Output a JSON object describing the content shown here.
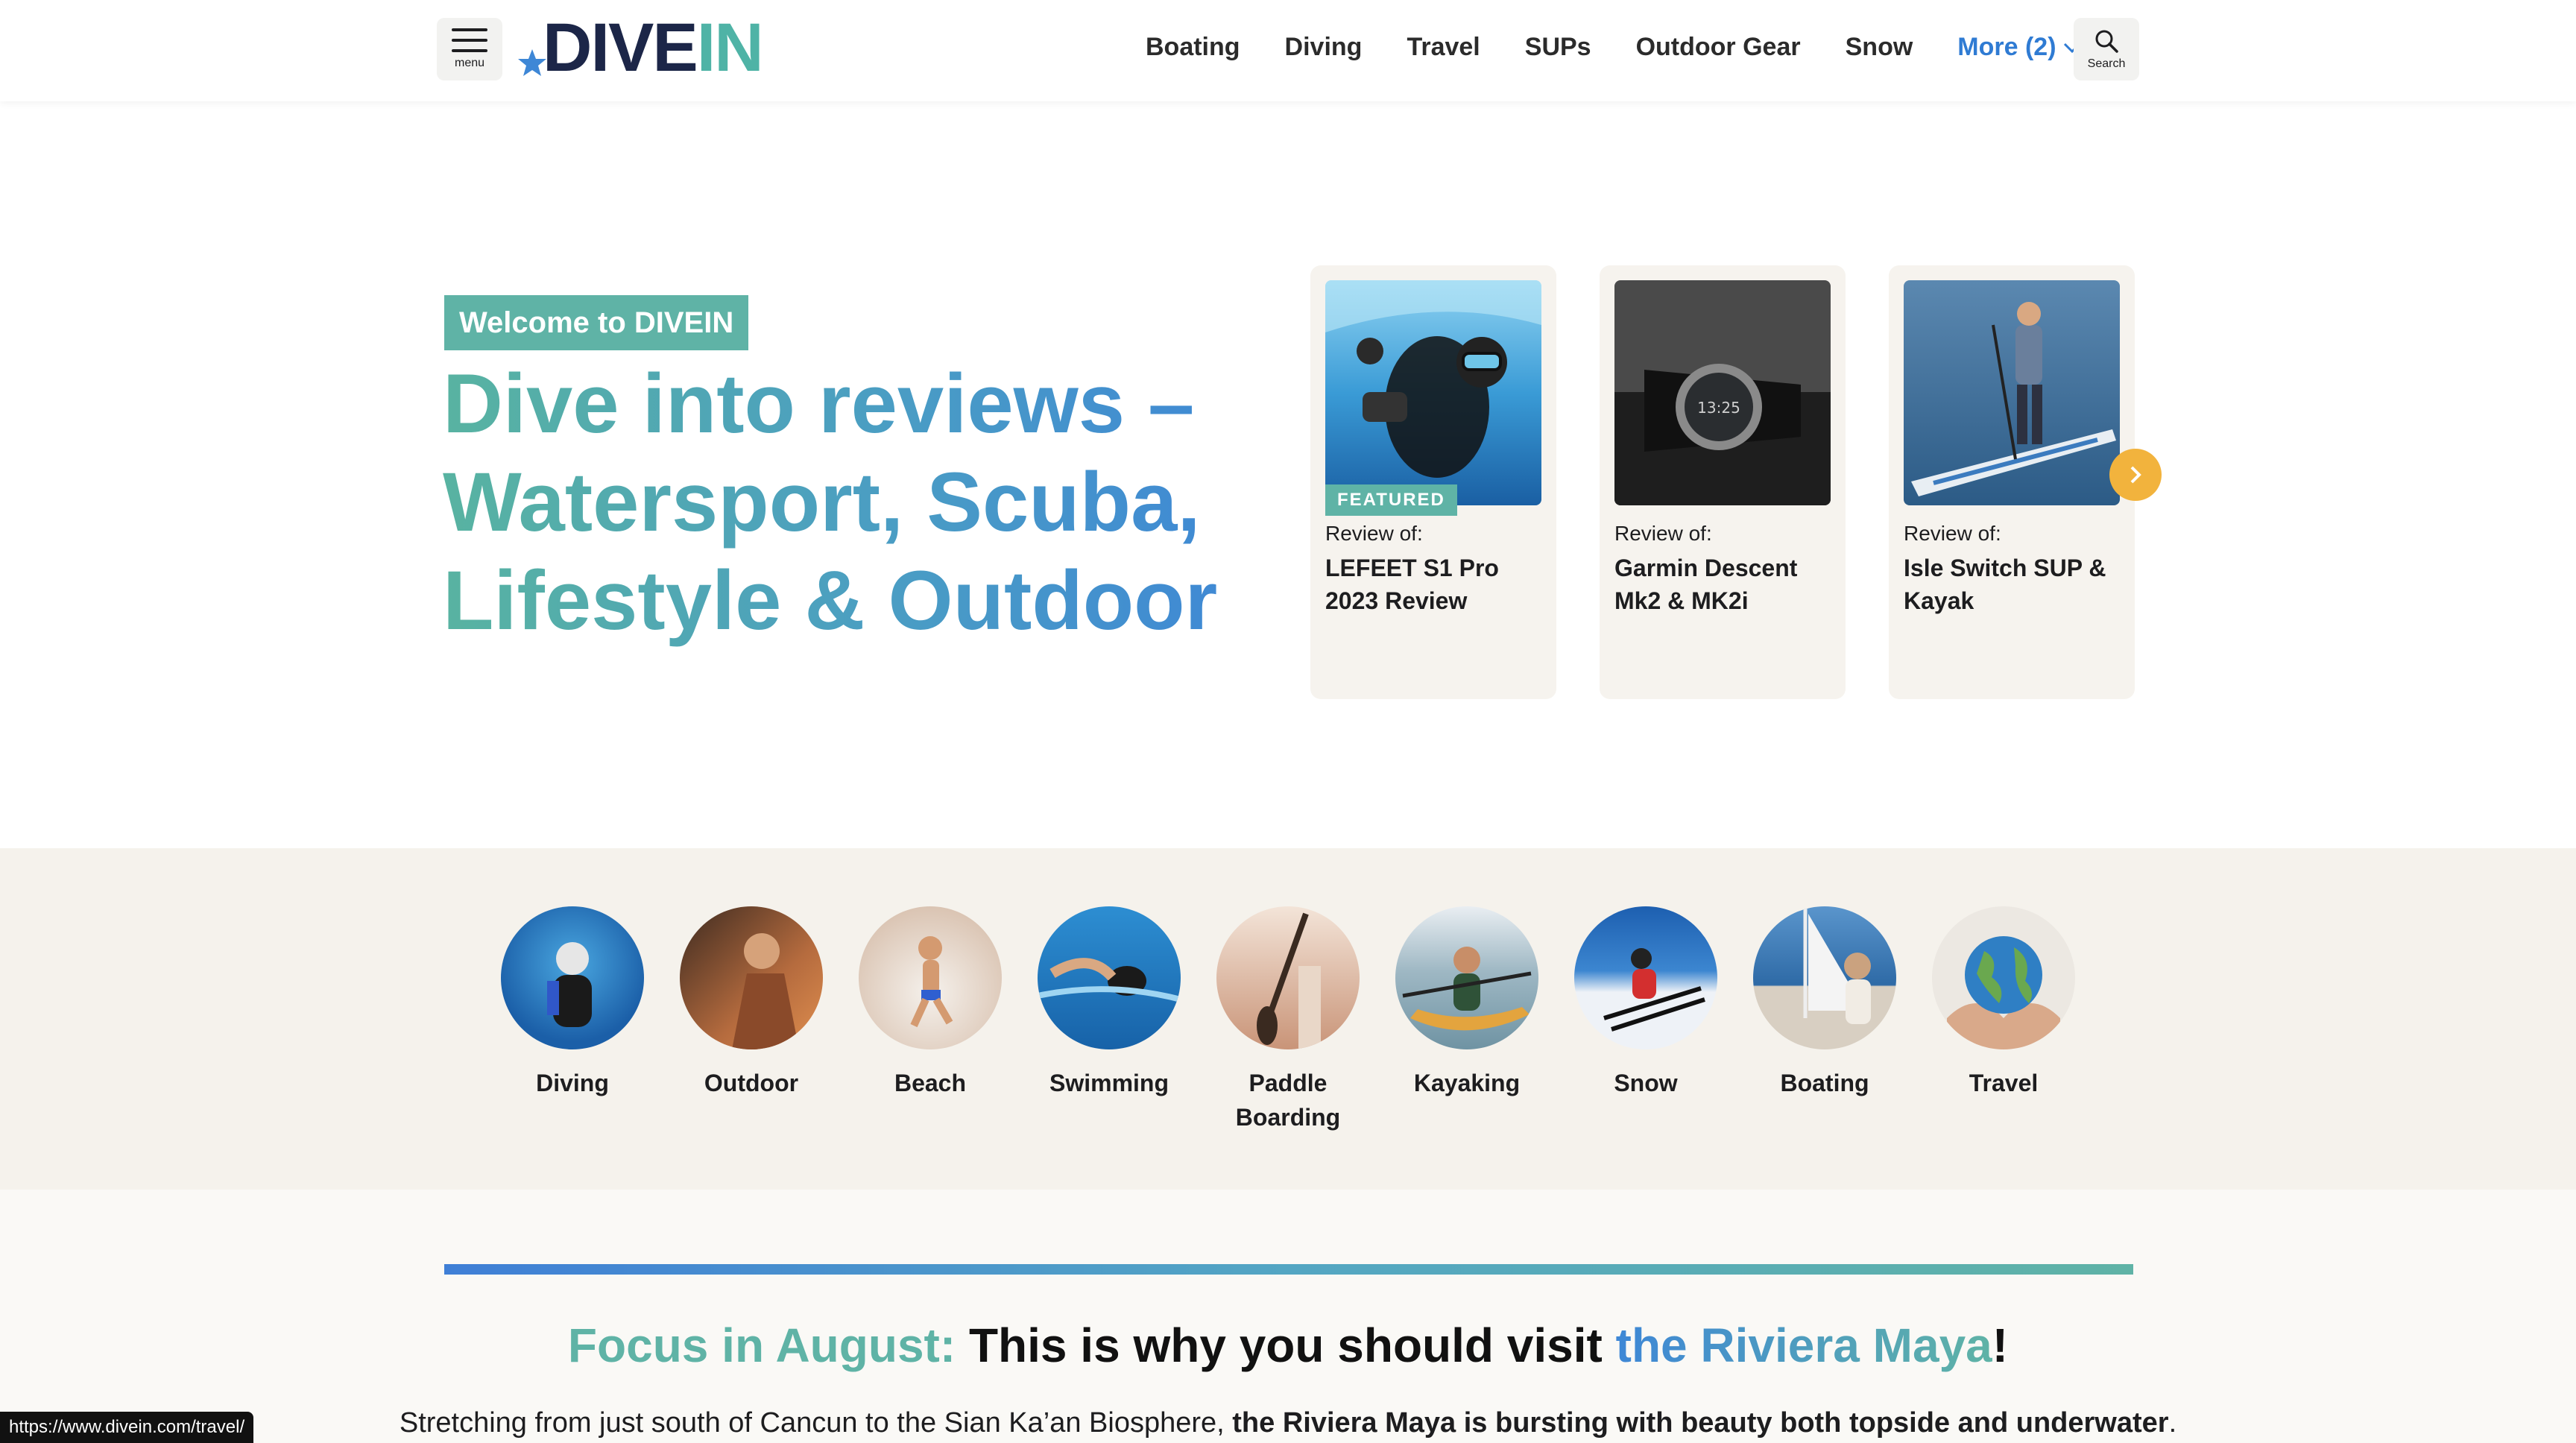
{
  "header": {
    "menu_label": "menu",
    "logo_part1": "DIVE",
    "logo_part2": "IN",
    "nav": [
      "Boating",
      "Diving",
      "Travel",
      "SUPs",
      "Outdoor Gear",
      "Snow"
    ],
    "more_label": "More (2)",
    "search_label": "Search"
  },
  "hero": {
    "badge": "Welcome to DIVEIN",
    "title_lines": [
      "Dive into reviews –",
      "Watersport, Scuba,",
      "Lifestyle & Outdoor"
    ]
  },
  "cards": [
    {
      "featured": "FEATURED",
      "review_of": "Review of:",
      "title": "LEFEET S1 Pro 2023 Review"
    },
    {
      "featured": "",
      "review_of": "Review of:",
      "title": "Garmin Descent Mk2 & MK2i"
    },
    {
      "featured": "",
      "review_of": "Review of:",
      "title": "Isle Switch SUP & Kayak"
    }
  ],
  "categories": [
    {
      "name": "Diving",
      "colors": [
        "#1b5fa8",
        "#3a9ad9"
      ]
    },
    {
      "name": "Outdoor",
      "colors": [
        "#5a3a2a",
        "#c87a4a"
      ]
    },
    {
      "name": "Beach",
      "colors": [
        "#e8e4de",
        "#d9b29a"
      ]
    },
    {
      "name": "Swimming",
      "colors": [
        "#1f7fc2",
        "#58b7e6"
      ]
    },
    {
      "name": "Paddle Boarding",
      "colors": [
        "#c89a7a",
        "#f0d8c6"
      ]
    },
    {
      "name": "Kayaking",
      "colors": [
        "#7fa8b8",
        "#e0a64a"
      ]
    },
    {
      "name": "Snow",
      "colors": [
        "#1d5fb0",
        "#e9eef5"
      ]
    },
    {
      "name": "Boating",
      "colors": [
        "#3a78b8",
        "#dcd2c6"
      ]
    },
    {
      "name": "Travel",
      "colors": [
        "#e9e5df",
        "#3b8ac9"
      ]
    }
  ],
  "focus": {
    "part1": "Focus in August:",
    "part2": " This is why you should visit ",
    "part3": "the Riviera Maya",
    "part4": "!"
  },
  "paragraph": {
    "normal": "Stretching from just south of Cancun to the Sian Ka’an Biosphere, ",
    "bold": "the Riviera Maya is bursting with beauty both topside and underwater",
    "end": "."
  },
  "status_url": "https://www.divein.com/travel/",
  "colors": {
    "teal": "#5fb3a6",
    "blue": "#3e87d6",
    "navy": "#1c2648",
    "accent_orange": "#f2b33d",
    "band": "#f5f2ec"
  }
}
